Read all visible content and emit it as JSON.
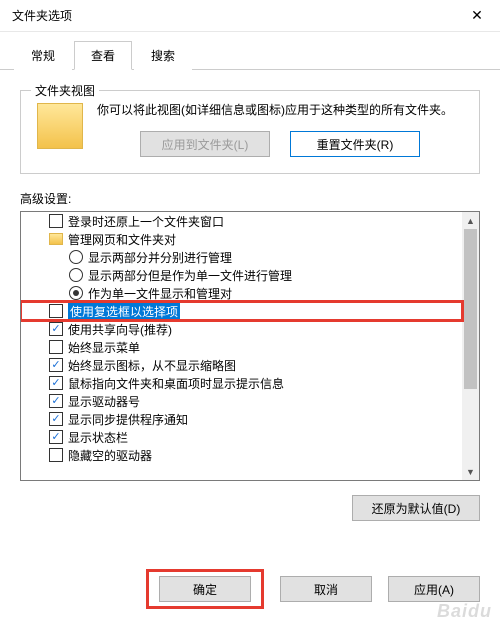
{
  "window": {
    "title": "文件夹选项"
  },
  "tabs": {
    "general": "常规",
    "view": "查看",
    "search": "搜索"
  },
  "folderViews": {
    "groupTitle": "文件夹视图",
    "desc": "你可以将此视图(如详细信息或图标)应用于这种类型的所有文件夹。",
    "applyBtn": "应用到文件夹(L)",
    "resetBtn": "重置文件夹(R)"
  },
  "advanced": {
    "label": "高级设置:",
    "items": [
      {
        "type": "check",
        "checked": false,
        "indent": 0,
        "text": "登录时还原上一个文件夹窗口"
      },
      {
        "type": "folder",
        "indent": 0,
        "text": "管理网页和文件夹对"
      },
      {
        "type": "radio",
        "checked": false,
        "indent": 1,
        "text": "显示两部分并分别进行管理"
      },
      {
        "type": "radio",
        "checked": false,
        "indent": 1,
        "text": "显示两部分但是作为单一文件进行管理"
      },
      {
        "type": "radio",
        "checked": true,
        "indent": 1,
        "text": "作为单一文件显示和管理对"
      },
      {
        "type": "check",
        "checked": false,
        "indent": 0,
        "text": "使用复选框以选择项",
        "highlighted": true
      },
      {
        "type": "check",
        "checked": true,
        "indent": 0,
        "text": "使用共享向导(推荐)"
      },
      {
        "type": "check",
        "checked": false,
        "indent": 0,
        "text": "始终显示菜单"
      },
      {
        "type": "check",
        "checked": true,
        "indent": 0,
        "text": "始终显示图标，从不显示缩略图"
      },
      {
        "type": "check",
        "checked": true,
        "indent": 0,
        "text": "鼠标指向文件夹和桌面项时显示提示信息"
      },
      {
        "type": "check",
        "checked": true,
        "indent": 0,
        "text": "显示驱动器号"
      },
      {
        "type": "check",
        "checked": true,
        "indent": 0,
        "text": "显示同步提供程序通知"
      },
      {
        "type": "check",
        "checked": true,
        "indent": 0,
        "text": "显示状态栏"
      },
      {
        "type": "check",
        "checked": false,
        "indent": 0,
        "text": "隐藏空的驱动器"
      }
    ],
    "restoreBtn": "还原为默认值(D)"
  },
  "buttons": {
    "ok": "确定",
    "cancel": "取消",
    "apply": "应用(A)"
  },
  "watermark": "Baidu"
}
